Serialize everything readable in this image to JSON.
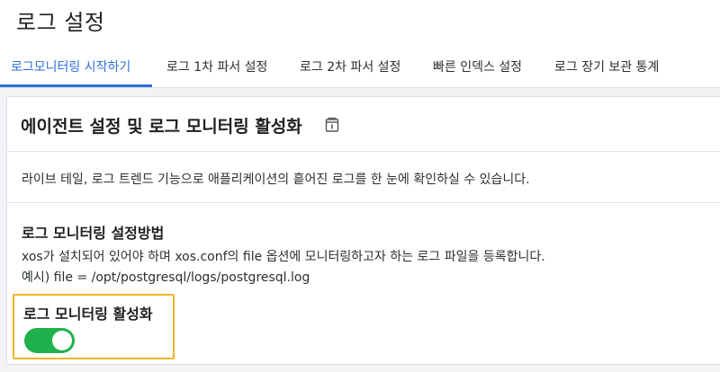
{
  "page": {
    "title": "로그 설정"
  },
  "tabs": [
    {
      "label": "로그모니터링 시작하기",
      "active": true
    },
    {
      "label": "로그 1차 파서 설정",
      "active": false
    },
    {
      "label": "로그 2차 파서 설정",
      "active": false
    },
    {
      "label": "빠른 인덱스 설정",
      "active": false
    },
    {
      "label": "로그 장기 보관 통계",
      "active": false
    }
  ],
  "card": {
    "title": "에이전트 설정 및 로그 모니터링 활성화",
    "info_icon": "book-info-icon",
    "description": "라이브 테일, 로그 트렌드 기능으로 애플리케이션의 흩어진 로그를 한 눈에 확인하실 수 있습니다.",
    "method": {
      "title": "로그 모니터링 설정방법",
      "line1": "xos가 설치되어 있어야 하며 xos.conf의 file 옵션에 모니터링하고자 하는 로그 파일을 등록합니다.",
      "line2": "예시) file = /opt/postgresql/logs/postgresql.log"
    },
    "toggle": {
      "label": "로그 모니터링 활성화",
      "on": true
    }
  },
  "colors": {
    "accent": "#2f6fd6",
    "toggle_on": "#1fb14b",
    "highlight": "#f0b429"
  }
}
